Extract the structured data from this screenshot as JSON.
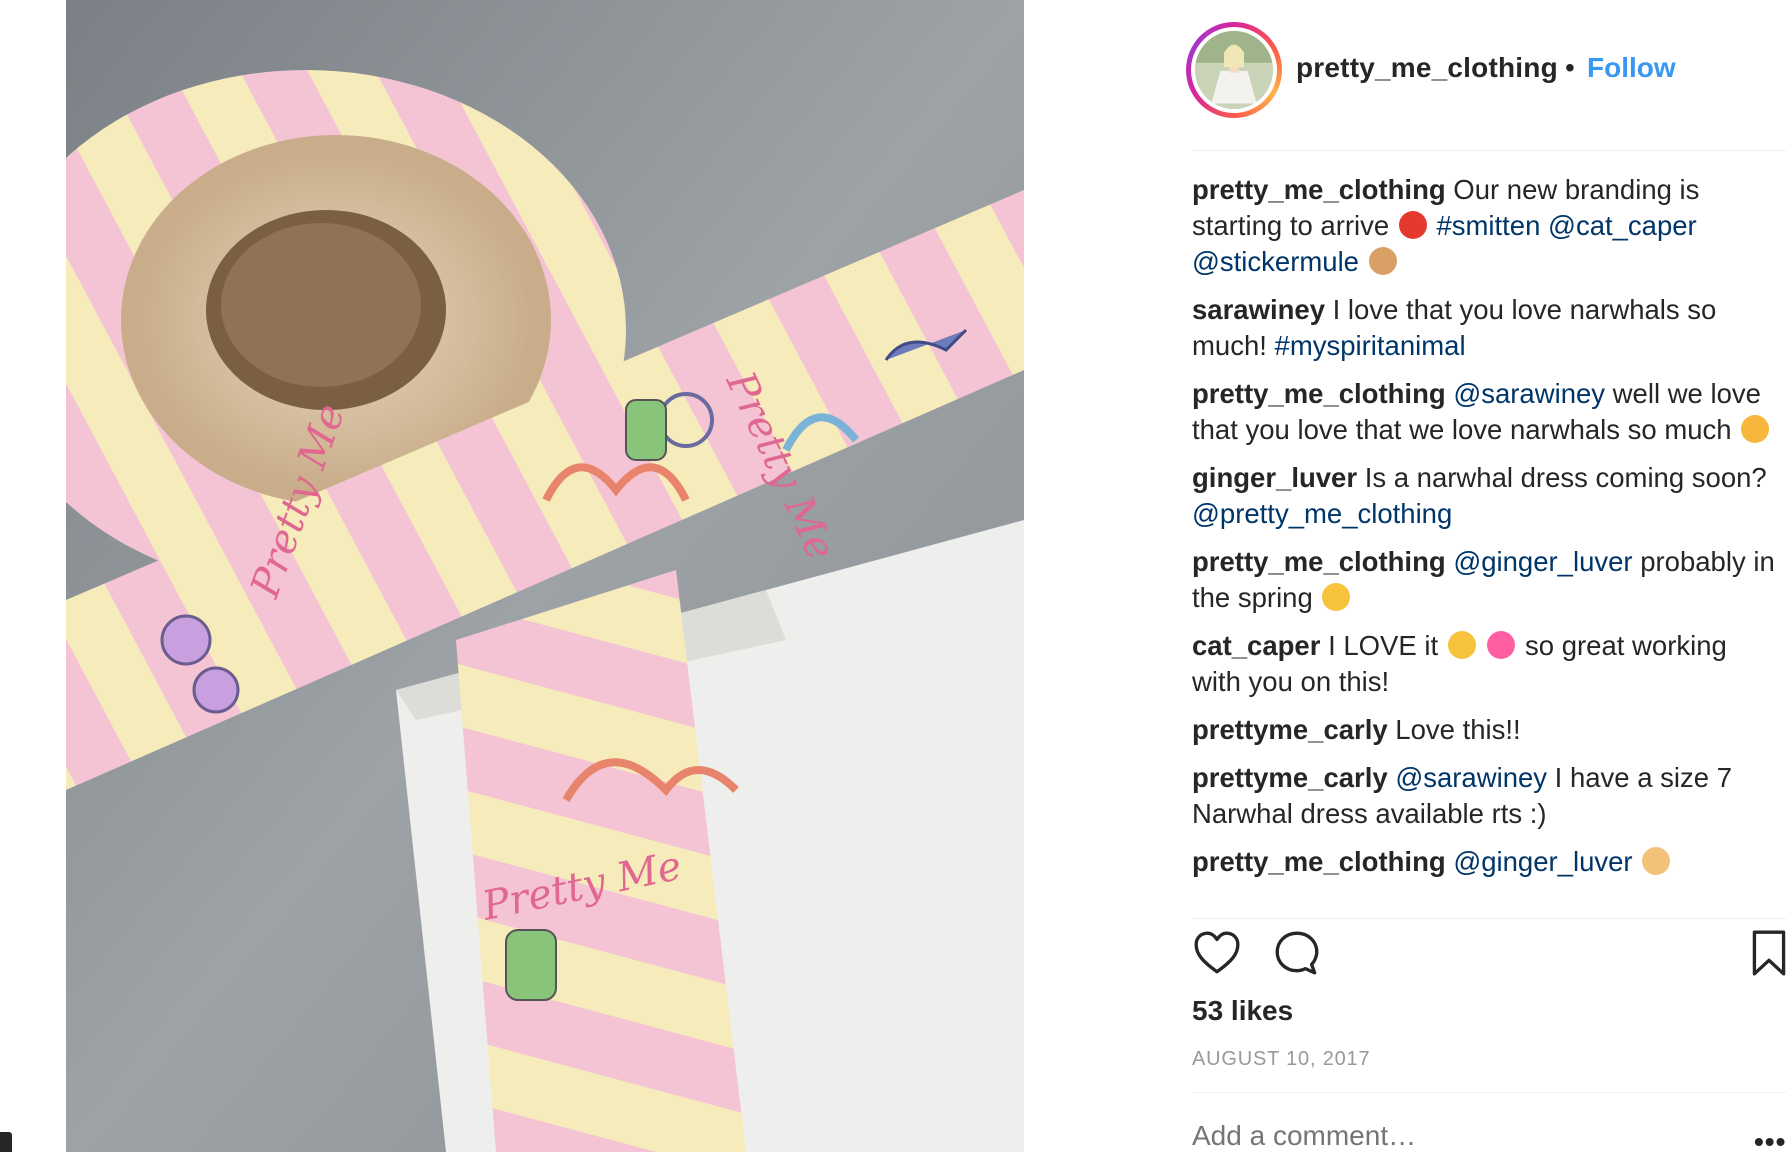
{
  "post": {
    "username": "pretty_me_clothing",
    "separator": "•",
    "follow_label": "Follow",
    "photo_tape_text": "Pretty Me",
    "likes": "53 likes",
    "date": "AUGUST 10, 2017",
    "add_comment_placeholder": "Add a comment…",
    "more_label": "•••"
  },
  "comments": [
    {
      "user": "pretty_me_clothing",
      "parts": [
        {
          "t": "text",
          "v": " Our new branding is starting to arrive "
        },
        {
          "t": "emoji",
          "v": "dancer-emoji",
          "c": "#e5382f"
        },
        {
          "t": "text",
          "v": " "
        },
        {
          "t": "tag",
          "v": "#smitten"
        },
        {
          "t": "text",
          "v": " "
        },
        {
          "t": "mention",
          "v": "@cat_caper"
        },
        {
          "t": "text",
          "v": " "
        },
        {
          "t": "mention",
          "v": "@stickermule"
        },
        {
          "t": "text",
          "v": " "
        },
        {
          "t": "emoji",
          "v": "raised-hands-emoji",
          "c": "#d9a066"
        }
      ]
    },
    {
      "user": "sarawiney",
      "parts": [
        {
          "t": "text",
          "v": " I love that you love narwhals so much! "
        },
        {
          "t": "tag",
          "v": "#myspiritanimal"
        }
      ]
    },
    {
      "user": "pretty_me_clothing",
      "parts": [
        {
          "t": "text",
          "v": " "
        },
        {
          "t": "mention",
          "v": "@sarawiney"
        },
        {
          "t": "text",
          "v": " well we love that you love that we love narwhals so much "
        },
        {
          "t": "emoji",
          "v": "kissing-cat-emoji",
          "c": "#f6b73c"
        }
      ]
    },
    {
      "user": "ginger_luver",
      "parts": [
        {
          "t": "text",
          "v": " Is a narwhal dress coming soon? "
        },
        {
          "t": "mention",
          "v": "@pretty_me_clothing"
        }
      ]
    },
    {
      "user": "pretty_me_clothing",
      "parts": [
        {
          "t": "text",
          "v": " "
        },
        {
          "t": "mention",
          "v": "@ginger_luver"
        },
        {
          "t": "text",
          "v": " probably in the spring "
        },
        {
          "t": "emoji",
          "v": "hugging-face-emoji",
          "c": "#f7c23c"
        }
      ]
    },
    {
      "user": "cat_caper",
      "parts": [
        {
          "t": "text",
          "v": " I LOVE it "
        },
        {
          "t": "emoji",
          "v": "heart-eyes-emoji",
          "c": "#f7c23c"
        },
        {
          "t": "text",
          "v": " "
        },
        {
          "t": "emoji",
          "v": "sparkling-heart-emoji",
          "c": "#ff5fa2"
        },
        {
          "t": "text",
          "v": "  so great working with you on this!"
        }
      ]
    },
    {
      "user": "prettyme_carly",
      "parts": [
        {
          "t": "text",
          "v": " Love this!!"
        }
      ]
    },
    {
      "user": "prettyme_carly",
      "parts": [
        {
          "t": "text",
          "v": " "
        },
        {
          "t": "mention",
          "v": "@sarawiney"
        },
        {
          "t": "text",
          "v": " I have a size 7 Narwhal dress available rts :)"
        }
      ]
    },
    {
      "user": "pretty_me_clothing",
      "parts": [
        {
          "t": "text",
          "v": " "
        },
        {
          "t": "mention",
          "v": "@ginger_luver"
        },
        {
          "t": "text",
          "v": " "
        },
        {
          "t": "emoji",
          "v": "pointing-up-emoji",
          "c": "#f2c27a"
        }
      ]
    }
  ],
  "colors": {
    "link": "#3897f0",
    "mention": "#003569",
    "muted": "#999999",
    "text": "#262626",
    "tape_pink": "#f3c6d6",
    "tape_yellow": "#f5eab5",
    "tape_text": "#e0678f"
  }
}
